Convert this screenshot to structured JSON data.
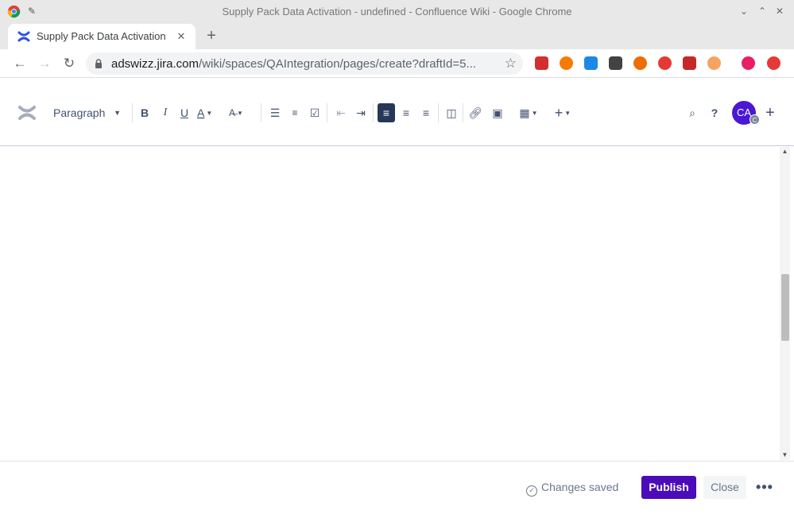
{
  "window": {
    "title": "Supply Pack Data Activation - undefined - Confluence Wiki - Google Chrome",
    "minimize_glyph": "⌄",
    "maximize_glyph": "⌃",
    "close_glyph": "✕"
  },
  "tab": {
    "title": "Supply Pack Data Activation",
    "close_glyph": "✕",
    "new_tab_glyph": "+"
  },
  "address_bar": {
    "host": "adswizz.jira.com",
    "path": "/wiki/spaces/QAIntegration/pages/create?draftId=5..."
  },
  "extensions": [
    {
      "name": "ext-red-badge-icon",
      "color": "#d32f2f"
    },
    {
      "name": "ext-orange-circle-icon",
      "color": "#f57c00"
    },
    {
      "name": "ext-download-icon",
      "color": "#1e88e5"
    },
    {
      "name": "ext-mask-icon",
      "color": "#424242"
    },
    {
      "name": "ext-flame-icon",
      "color": "#ef6c00"
    },
    {
      "name": "ext-stop-icon",
      "color": "#e53935"
    },
    {
      "name": "ext-forward-icon",
      "color": "#c62828"
    },
    {
      "name": "ext-face-icon",
      "color": "#f4a460"
    },
    {
      "name": "ext-profile-c-icon",
      "color": "#e91e63"
    },
    {
      "name": "ext-up-arrow-icon",
      "color": "#e53935"
    }
  ],
  "toolbar": {
    "text_style": "Paragraph",
    "bold": "B",
    "italic": "I",
    "underline": "U",
    "text_color": "A",
    "add_button": "+",
    "help": "?"
  },
  "user": {
    "initials": "CA",
    "badge": "C"
  },
  "footer": {
    "status": "Changes saved",
    "publish_label": "Publish",
    "close_label": "Close",
    "more_label": "•••"
  },
  "colors": {
    "publish_bg": "#4b0bb8",
    "avatar_bg": "#4b16d6",
    "active_align_bg": "#253858"
  }
}
